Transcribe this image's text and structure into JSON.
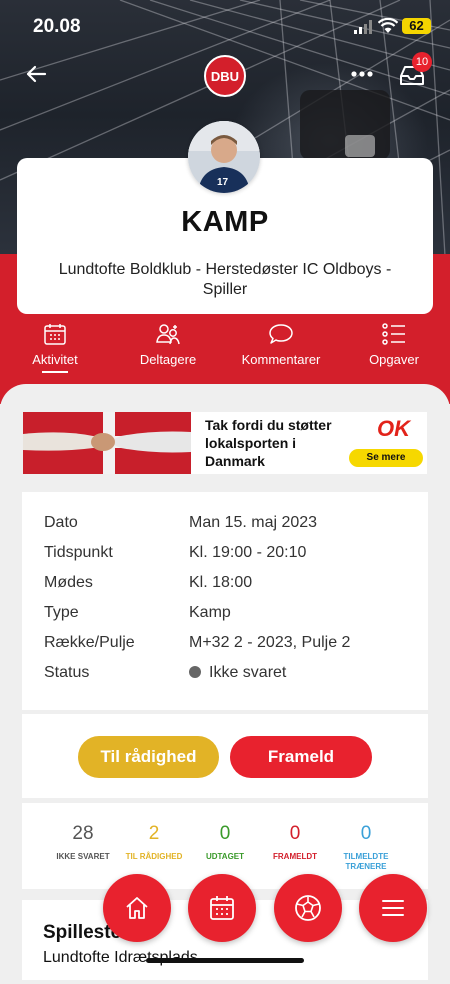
{
  "status_bar": {
    "time": "20.08",
    "battery": "62"
  },
  "nav": {
    "notification_count": "10",
    "logo_text": "DBU"
  },
  "event": {
    "title": "KAMP",
    "subtitle": "Lundtofte Boldklub - Herstedøster IC Oldboys - Spiller",
    "player_number": "17"
  },
  "tabs": [
    {
      "label": "Aktivitet",
      "active": true,
      "icon": "calendar-icon"
    },
    {
      "label": "Deltagere",
      "active": false,
      "icon": "people-icon"
    },
    {
      "label": "Kommentarer",
      "active": false,
      "icon": "comment-icon"
    },
    {
      "label": "Opgaver",
      "active": false,
      "icon": "checklist-icon"
    }
  ],
  "ad": {
    "text": "Tak fordi du støtter lokalsporten i Danmark",
    "brand": "OK",
    "button": "Se mere"
  },
  "details": [
    {
      "key": "Dato",
      "value": "Man 15. maj 2023"
    },
    {
      "key": "Tidspunkt",
      "value": "Kl. 19:00 - 20:10"
    },
    {
      "key": "Mødes",
      "value": "Kl. 18:00"
    },
    {
      "key": "Type",
      "value": "Kamp"
    },
    {
      "key": "Række/Pulje",
      "value": "M+32 2 - 2023, Pulje 2"
    },
    {
      "key": "Status",
      "value": "Ikke svaret"
    }
  ],
  "actions": {
    "available": "Til rådighed",
    "decline": "Frameld"
  },
  "stats": [
    {
      "count": "28",
      "label": "IKKE SVARET",
      "color": "#555555"
    },
    {
      "count": "2",
      "label": "TIL RÅDIGHED",
      "color": "#e2b326"
    },
    {
      "count": "0",
      "label": "UDTAGET",
      "color": "#3a9a2a"
    },
    {
      "count": "0",
      "label": "FRAMELDT",
      "color": "#d31f2b"
    },
    {
      "count": "0",
      "label": "TILMELDTE TRÆNERE",
      "color": "#3aa0d8"
    }
  ],
  "venue": {
    "heading": "Spillested",
    "name": "Lundtofte Idrætsplads"
  },
  "fab_icons": [
    "home-icon",
    "calendar-icon",
    "football-icon",
    "menu-icon"
  ],
  "colors": {
    "brand_red": "#d31f2b",
    "accent_yellow": "#e2b326"
  }
}
